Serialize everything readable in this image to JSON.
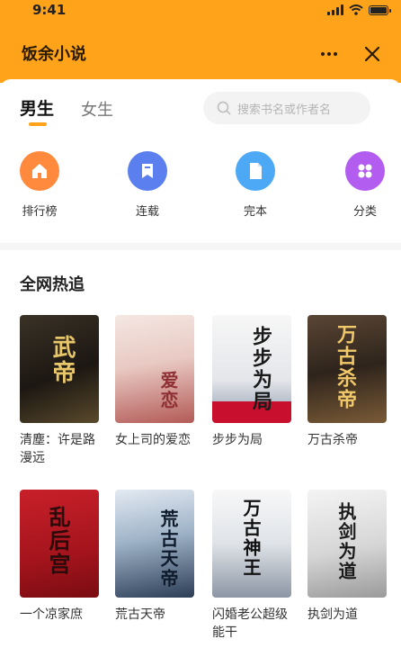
{
  "status_bar": {
    "time": "9:41"
  },
  "header": {
    "title": "饭余小说"
  },
  "tabs": [
    {
      "label": "男生",
      "active": true
    },
    {
      "label": "女生",
      "active": false
    }
  ],
  "search": {
    "placeholder": "搜索书名或作者名"
  },
  "categories": [
    {
      "label": "排行榜",
      "icon": "home-icon",
      "color": "#FF8A3D"
    },
    {
      "label": "连载",
      "icon": "bookmark-icon",
      "color": "#5B7FEF"
    },
    {
      "label": "完本",
      "icon": "book-icon",
      "color": "#4DA9F5"
    },
    {
      "label": "分类",
      "icon": "grid-icon",
      "color": "#B25CF0"
    }
  ],
  "section": {
    "title": "全网热追"
  },
  "books": [
    {
      "title": "清塵：许是路漫远",
      "cover_text": "武帝"
    },
    {
      "title": "女上司的爱恋",
      "cover_text": "爱恋"
    },
    {
      "title": "步步为局",
      "cover_text": "步步为局"
    },
    {
      "title": "万古杀帝",
      "cover_text": "万古杀帝"
    },
    {
      "title": "一个凉家庶",
      "cover_text": "乱后宫"
    },
    {
      "title": "荒古天帝",
      "cover_text": "荒古天帝"
    },
    {
      "title": "闪婚老公超级能干",
      "cover_text": "万古神王"
    },
    {
      "title": "执剑为道",
      "cover_text": "执剑为道"
    }
  ],
  "colors": {
    "accent": "#FFA31A"
  }
}
